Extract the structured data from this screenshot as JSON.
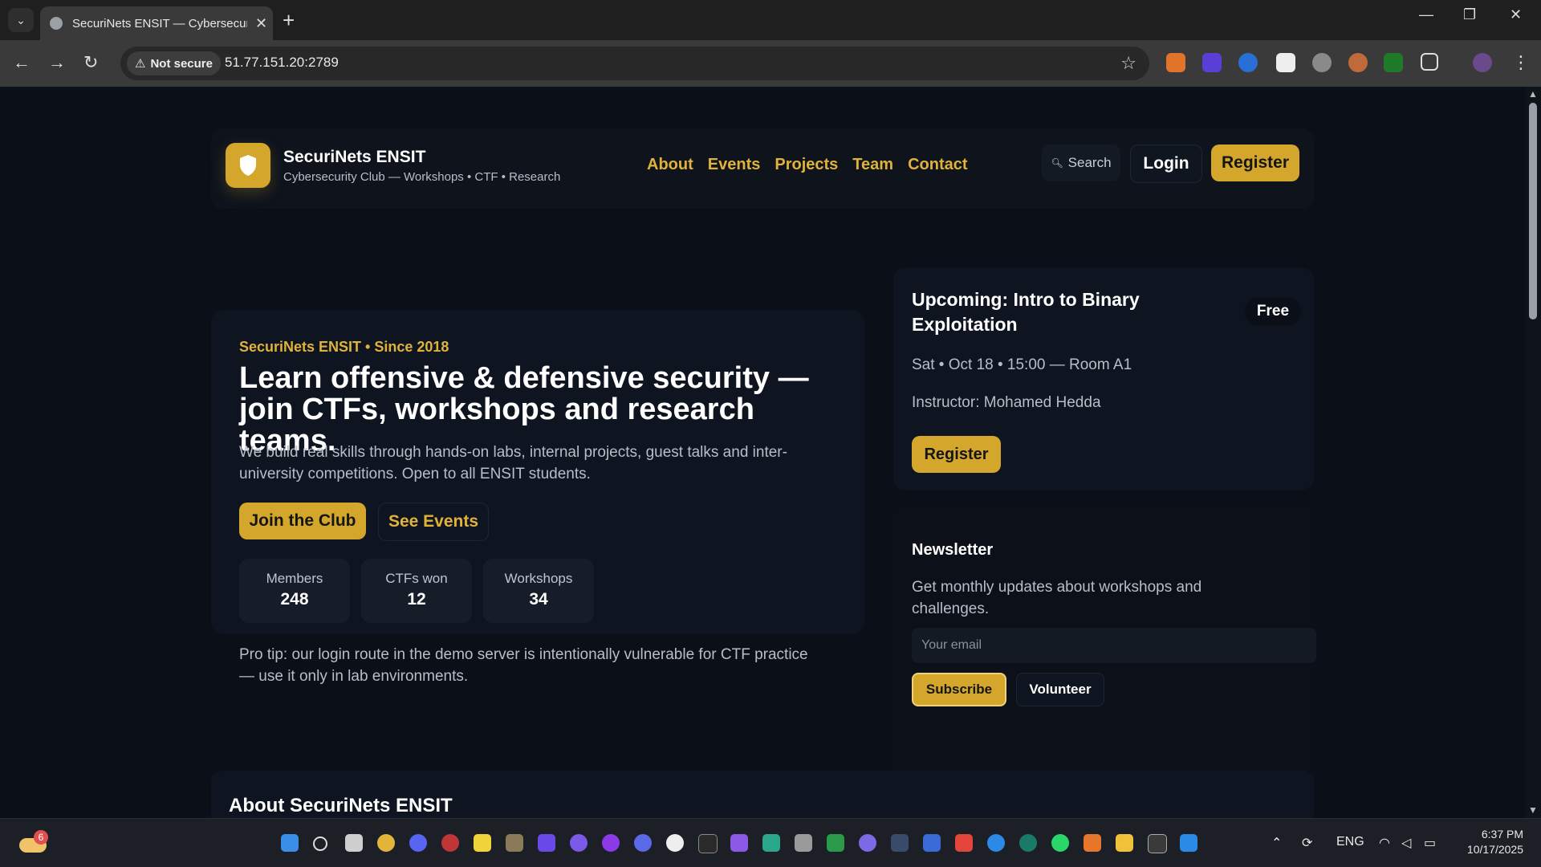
{
  "browser": {
    "tab_title": "SecuriNets ENSIT — Cybersecurity Club",
    "tab_close": "✕",
    "new_tab": "+",
    "security_chip": "Not secure",
    "url": "51.77.151.20:2789",
    "window_controls": {
      "minimize": "—",
      "restore": "❐",
      "close": "✕"
    }
  },
  "site": {
    "brand": "SecuriNets ENSIT",
    "tagline": "Cybersecurity Club — Workshops • CTF • Research",
    "nav": [
      "About",
      "Events",
      "Projects",
      "Team",
      "Contact"
    ],
    "search_label": "Search",
    "login_label": "Login",
    "register_label": "Register"
  },
  "hero": {
    "eyebrow": "SecuriNets ENSIT • Since 2018",
    "headline": "Learn offensive & defensive security — join CTFs, workshops and research teams.",
    "lede": "We build real skills through hands-on labs, internal projects, guest talks and inter-university competitions. Open to all ENSIT students.",
    "join_label": "Join the Club",
    "events_label": "See Events",
    "stats": [
      {
        "label": "Members",
        "value": "248"
      },
      {
        "label": "CTFs won",
        "value": "12"
      },
      {
        "label": "Workshops",
        "value": "34"
      }
    ],
    "protip": "Pro tip: our login route in the demo server is intentionally vulnerable for CTF practice — use it only in lab environments."
  },
  "event": {
    "title": "Upcoming: Intro to Binary Exploitation",
    "badge": "Free",
    "date": "Sat • Oct 18 • 15:00 — Room A1",
    "instructor": "Instructor: Mohamed Hedda",
    "register_label": "Register"
  },
  "newsletter": {
    "title": "Newsletter",
    "description": "Get monthly updates about workshops and challenges.",
    "email_placeholder": "Your email",
    "subscribe_label": "Subscribe",
    "volunteer_label": "Volunteer"
  },
  "about": {
    "title": "About SecuriNets ENSIT"
  },
  "taskbar": {
    "weather_badge": "6",
    "language": "ENG",
    "time": "6:37 PM",
    "date": "10/17/2025"
  },
  "colors": {
    "accent": "#d4a72c",
    "page_background": "#0b1018",
    "card_background": "#0f1520"
  }
}
